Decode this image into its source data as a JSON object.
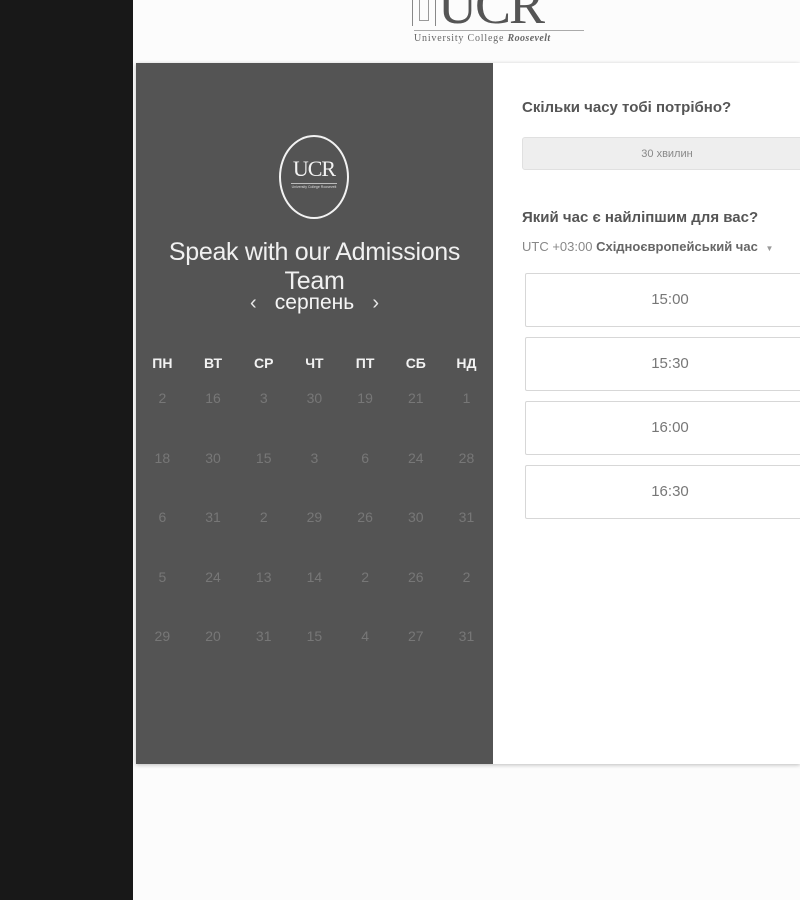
{
  "header": {
    "logo_mark": "UCR",
    "logo_subtitle_regular": "University College ",
    "logo_subtitle_italic": "Roosevelt"
  },
  "calendar": {
    "logo_mark": "UCR",
    "logo_tiny": "University College Roosevelt",
    "title": "Speak with our Admissions Team",
    "month": "серпень",
    "prev_arrow": "‹",
    "next_arrow": "›",
    "weekdays": [
      "ПН",
      "ВТ",
      "СР",
      "ЧТ",
      "ПТ",
      "СБ",
      "НД"
    ],
    "weeks": [
      [
        "2",
        "16",
        "3",
        "30",
        "19",
        "21",
        "1"
      ],
      [
        "18",
        "30",
        "15",
        "3",
        "6",
        "24",
        "28"
      ],
      [
        "6",
        "31",
        "2",
        "29",
        "26",
        "30",
        "31"
      ],
      [
        "5",
        "24",
        "13",
        "14",
        "2",
        "26",
        "2"
      ],
      [
        "29",
        "20",
        "31",
        "15",
        "4",
        "27",
        "31"
      ]
    ]
  },
  "booking": {
    "duration_question": "Скільки часу тобі потрібно?",
    "duration_value": "30 хвилин",
    "time_question": "Який час є найліпшим для вас?",
    "timezone_offset": "UTC +03:00",
    "timezone_name": "Східноєвропейський час",
    "timezone_caret": "▼",
    "slots": [
      "15:00",
      "15:30",
      "16:00",
      "16:30"
    ]
  }
}
